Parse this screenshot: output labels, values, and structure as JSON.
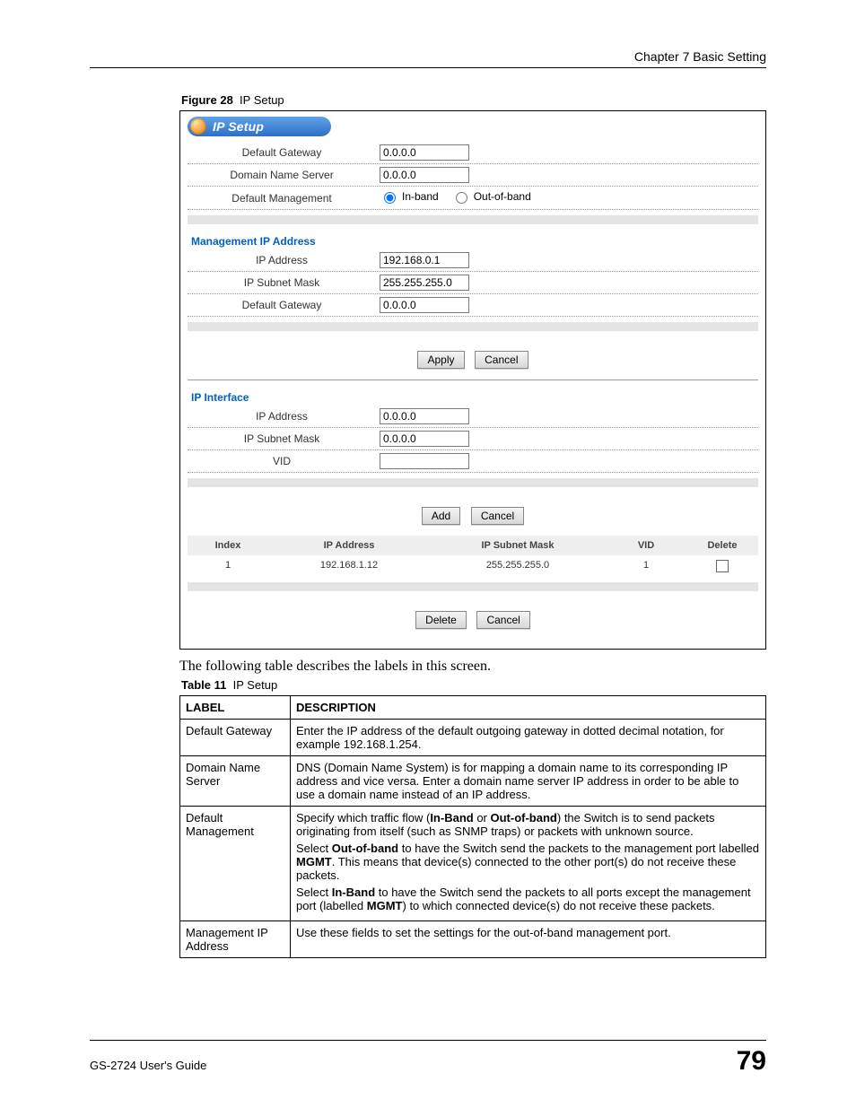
{
  "header": {
    "chapter": "Chapter 7 Basic Setting"
  },
  "figure": {
    "label": "Figure 28",
    "title": "IP Setup"
  },
  "panel": {
    "pill_title": "IP Setup",
    "sec1": {
      "default_gateway_label": "Default Gateway",
      "default_gateway_value": "0.0.0.0",
      "dns_label": "Domain Name Server",
      "dns_value": "0.0.0.0",
      "defmgmt_label": "Default Management",
      "radio_inband": "In-band",
      "radio_outband": "Out-of-band"
    },
    "sec2": {
      "title": "Management IP Address",
      "ip_label": "IP Address",
      "ip_value": "192.168.0.1",
      "mask_label": "IP Subnet Mask",
      "mask_value": "255.255.255.0",
      "gw_label": "Default Gateway",
      "gw_value": "0.0.0.0",
      "apply_btn": "Apply",
      "cancel_btn": "Cancel"
    },
    "sec3": {
      "title": "IP Interface",
      "ip_label": "IP Address",
      "ip_value": "0.0.0.0",
      "mask_label": "IP Subnet Mask",
      "mask_value": "0.0.0.0",
      "vid_label": "VID",
      "vid_value": "",
      "add_btn": "Add",
      "cancel_btn": "Cancel"
    },
    "grid": {
      "h_index": "Index",
      "h_ip": "IP Address",
      "h_mask": "IP Subnet Mask",
      "h_vid": "VID",
      "h_del": "Delete",
      "rows": [
        {
          "index": "1",
          "ip": "192.168.1.12",
          "mask": "255.255.255.0",
          "vid": "1"
        }
      ],
      "delete_btn": "Delete",
      "cancel_btn": "Cancel"
    }
  },
  "bodytext": "The following table describes the labels in this screen.",
  "table": {
    "caption_label": "Table 11",
    "caption_title": "IP Setup",
    "h_label": "LABEL",
    "h_desc": "DESCRIPTION",
    "r1_label": "Default Gateway",
    "r1_desc": "Enter the IP address of the default outgoing gateway in dotted decimal notation, for example 192.168.1.254.",
    "r2_label": "Domain Name Server",
    "r2_desc": "DNS (Domain Name System) is for mapping a domain name to its corresponding IP address and vice versa. Enter a domain name server IP address in order to be able to use a domain name instead of an IP address.",
    "r3_label": "Default Management",
    "r3_p1_a": "Specify which traffic flow (",
    "r3_p1_b": "In-Band",
    "r3_p1_c": " or ",
    "r3_p1_d": "Out-of-band",
    "r3_p1_e": ") the Switch is to send packets originating from itself (such as SNMP traps) or packets with unknown source.",
    "r3_p2_a": "Select ",
    "r3_p2_b": "Out-of-band",
    "r3_p2_c": " to have the Switch send the packets to the management port labelled ",
    "r3_p2_d": "MGMT",
    "r3_p2_e": ". This means that device(s) connected to the other port(s) do not receive these packets.",
    "r3_p3_a": "Select ",
    "r3_p3_b": "In-Band",
    "r3_p3_c": " to have the Switch send the packets to all ports except the management port (labelled ",
    "r3_p3_d": "MGMT",
    "r3_p3_e": ") to which connected device(s) do not receive these packets.",
    "r4_label": "Management IP Address",
    "r4_desc": "Use these fields to set the settings for the out-of-band management port."
  },
  "footer": {
    "guide": "GS-2724 User's Guide",
    "page": "79"
  }
}
